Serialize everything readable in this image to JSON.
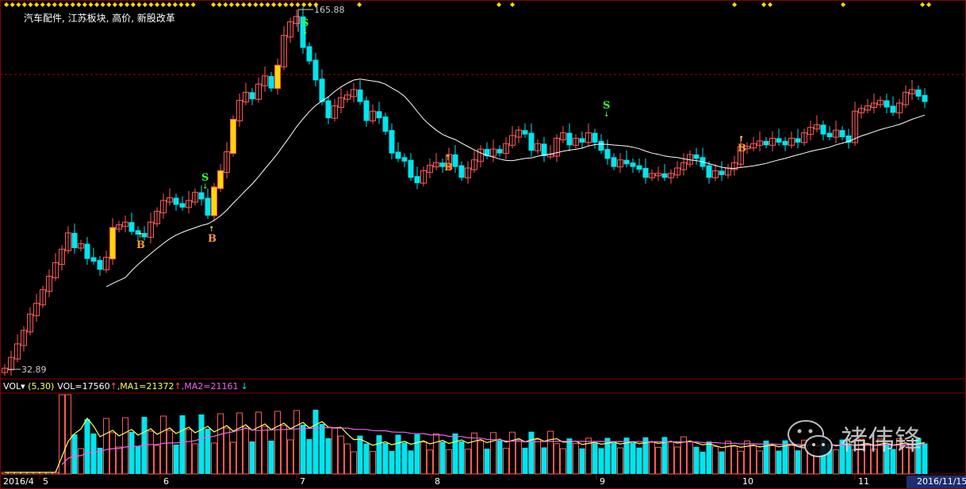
{
  "title": "汽车配件, 江苏板块, 高价, 新股改革",
  "price_high_label": "165.88",
  "price_low_label": "32.89",
  "vol_header": {
    "indicator": "VOL",
    "params": "(5,30)",
    "vol": "VOL=17560",
    "ma1": ",MA1=21372",
    "ma2": ",MA2=21161"
  },
  "x_axis": {
    "start_label": "2016/4",
    "end_label": "2016/11/15",
    "months": [
      "5",
      "6",
      "7",
      "8",
      "9",
      "10",
      "11"
    ]
  },
  "watermark": "褚伟锋",
  "colors": {
    "background": "#000000",
    "up": "#ff5a5a",
    "down": "#00e5ee",
    "ma": "#ffffff",
    "vol_ma1": "#ffff55",
    "vol_ma2": "#ee66ee",
    "signal_buy": "#ff9933",
    "signal_sell": "#33ff33",
    "highlight": "#ffd700",
    "grid": "#8b0000"
  },
  "chart_data": {
    "type": "candlestick",
    "ylim": [
      32.89,
      165.88
    ],
    "y_high": 165.88,
    "y_low": 32.89,
    "signals": [
      {
        "type": "B",
        "label": "B",
        "at_month": "5"
      },
      {
        "type": "S",
        "label": "S",
        "at_month": "6"
      },
      {
        "type": "B",
        "label": "B",
        "at_month": "6"
      },
      {
        "type": "S",
        "label": "S",
        "at_month": "7"
      },
      {
        "type": "B",
        "label": "B",
        "at_month": "8"
      },
      {
        "type": "S",
        "label": "S",
        "at_month": "9"
      },
      {
        "type": "B",
        "label": "B",
        "at_month": "10"
      }
    ],
    "volume": {
      "last": 17560,
      "ma1": 21372,
      "ma2": 21161,
      "ma_periods": [
        5,
        30
      ]
    }
  }
}
